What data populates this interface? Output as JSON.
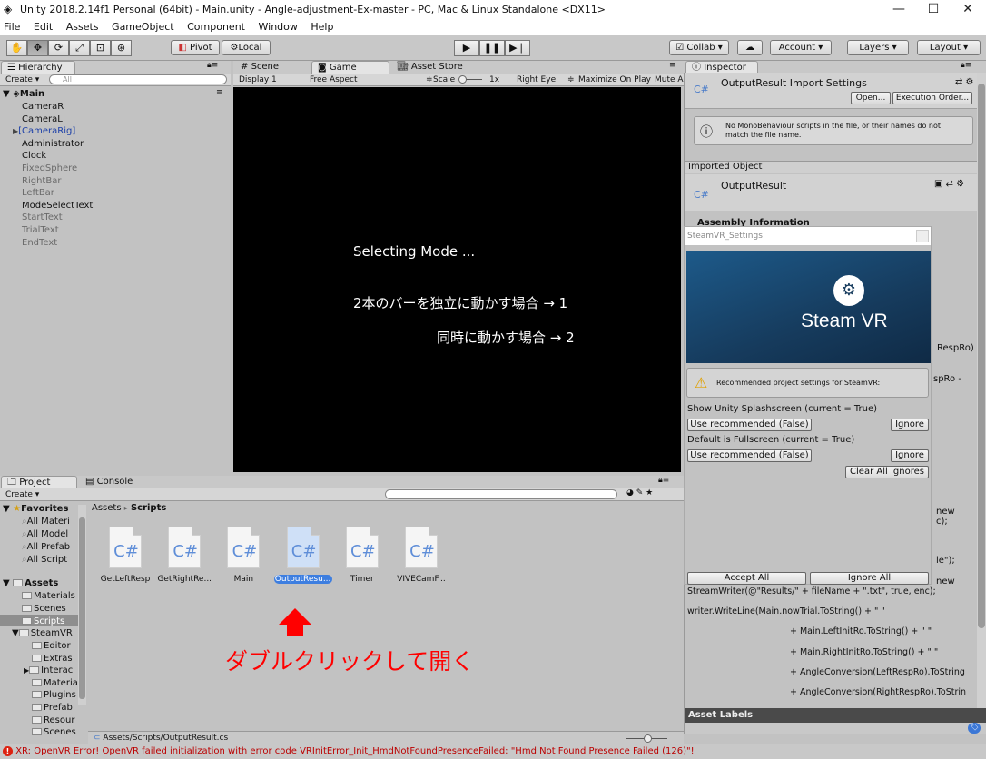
{
  "window": {
    "title": "Unity 2018.2.14f1 Personal (64bit) - Main.unity - Angle-adjustment-Ex-master - PC, Mac & Linux Standalone <DX11>",
    "minimize": "—",
    "maximize": "☐",
    "close": "✕"
  },
  "menu": [
    "File",
    "Edit",
    "Assets",
    "GameObject",
    "Component",
    "Window",
    "Help"
  ],
  "toolbar": {
    "pivot": "Pivot",
    "local": "Local",
    "collab": "Collab ▾",
    "account": "Account",
    "layers": "Layers",
    "layout": "Layout"
  },
  "hierarchy": {
    "tab": "Hierarchy",
    "create": "Create ▾",
    "search_placeholder": "All",
    "scene": "Main",
    "items": [
      {
        "label": "CameraR",
        "color": "#111111"
      },
      {
        "label": "CameraL",
        "color": "#111111"
      },
      {
        "label": "[CameraRig]",
        "color": "#1b3fa8"
      },
      {
        "label": "Administrator",
        "color": "#111111"
      },
      {
        "label": "Clock",
        "color": "#111111"
      },
      {
        "label": "FixedSphere",
        "color": "#6a6a6a"
      },
      {
        "label": "RightBar",
        "color": "#6a6a6a"
      },
      {
        "label": "LeftBar",
        "color": "#6a6a6a"
      },
      {
        "label": "ModeSelectText",
        "color": "#111111"
      },
      {
        "label": "StartText",
        "color": "#6a6a6a"
      },
      {
        "label": "TrialText",
        "color": "#6a6a6a"
      },
      {
        "label": "EndText",
        "color": "#6a6a6a"
      }
    ]
  },
  "view_tabs": {
    "scene": "Scene",
    "game": "Game",
    "asset_store": "Asset Store"
  },
  "game_bar": {
    "display": "Display 1",
    "aspect": "Free Aspect",
    "scale_label": "Scale",
    "scale_value": "1x",
    "eye": "Right Eye",
    "maximize": "Maximize On Play",
    "mute": "Mute A"
  },
  "game_view": {
    "line1": "Selecting Mode ...",
    "line2": "2本のバーを独立に動かす場合 → 1",
    "line3": "同時に動かす場合 → 2"
  },
  "inspector": {
    "tab": "Inspector",
    "title": "OutputResult Import Settings",
    "open": "Open...",
    "exec_order": "Execution Order...",
    "info": "No MonoBehaviour scripts in the file, or their names do not match the file name.",
    "imported_object": "Imported Object",
    "object_name": "OutputResult",
    "assembly": "Assembly Information",
    "code_lines": [
      "RespRo)",
      "spRo -",
      "new",
      "c);",
      "le\");",
      "new",
      "StreamWriter(@\"Results/\" + fileName + \".txt\", true, enc);",
      "writer.WriteLine(Main.nowTrial.ToString() + \" \"",
      "+ Main.LeftInitRo.ToString() + \" \"",
      "+ Main.RightInitRo.ToString() + \" \"",
      "+ AngleConversion(LeftRespRo).ToString",
      "+ AngleConversion(RightRespRo).ToStrin"
    ],
    "asset_labels": "Asset Labels"
  },
  "steamvr": {
    "title": "SteamVR_Settings",
    "logo": "Steam VR",
    "recommended": "Recommended project settings for SteamVR:",
    "setting1": "Show Unity Splashscreen (current = True)",
    "use1": "Use recommended (False)",
    "ignore1": "Ignore",
    "setting2": "Default is Fullscreen (current = True)",
    "use2": "Use recommended (False)",
    "ignore2": "Ignore",
    "clear": "Clear All Ignores",
    "accept": "Accept All",
    "ignore_all": "Ignore All"
  },
  "project": {
    "tab": "Project",
    "console_tab": "Console",
    "create": "Create ▾",
    "favorites": "Favorites",
    "fav_items": [
      "All Materi",
      "All Model",
      "All Prefab",
      "All Script"
    ],
    "assets": "Assets",
    "asset_items": [
      "Materials",
      "Scenes",
      "Scripts",
      "SteamVR"
    ],
    "steam_items": [
      "Editor",
      "Extras",
      "Interac",
      "Materia",
      "Plugins",
      "Prefab",
      "Resour",
      "Scenes"
    ],
    "breadcrumb_root": "Assets",
    "breadcrumb_sep": "▸",
    "breadcrumb_current": "Scripts",
    "files": [
      "GetLeftResp",
      "GetRightRe...",
      "Main",
      "OutputResu...",
      "Timer",
      "VIVECamF..."
    ],
    "cs_label": "C#",
    "path": "Assets/Scripts/OutputResult.cs",
    "annotation": "ダブルクリックして開く"
  },
  "status": {
    "message": "XR: OpenVR Error! OpenVR failed initialization with error code VRInitError_Init_HmdNotFoundPresenceFailed: \"Hmd Not Found Presence Failed (126)\"!"
  }
}
